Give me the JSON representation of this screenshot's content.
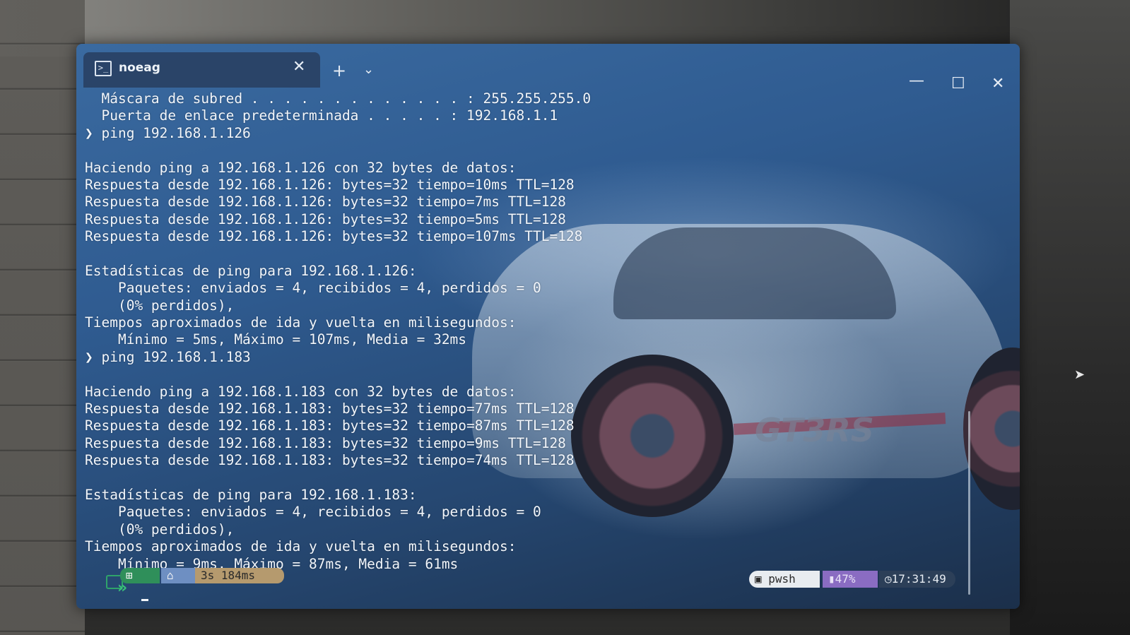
{
  "window": {
    "tab_title": "noeag",
    "tab_close": "✕",
    "new_tab": "+",
    "dropdown": "⌄",
    "minimize": "—",
    "maximize": "☐",
    "close": "✕"
  },
  "terminal": {
    "lines": [
      "  Máscara de subred . . . . . . . . . . . . . : 255.255.255.0",
      "  Puerta de enlace predeterminada . . . . . : 192.168.1.1",
      "❯ ping 192.168.1.126",
      "",
      "Haciendo ping a 192.168.1.126 con 32 bytes de datos:",
      "Respuesta desde 192.168.1.126: bytes=32 tiempo=10ms TTL=128",
      "Respuesta desde 192.168.1.126: bytes=32 tiempo=7ms TTL=128",
      "Respuesta desde 192.168.1.126: bytes=32 tiempo=5ms TTL=128",
      "Respuesta desde 192.168.1.126: bytes=32 tiempo=107ms TTL=128",
      "",
      "Estadísticas de ping para 192.168.1.126:",
      "    Paquetes: enviados = 4, recibidos = 4, perdidos = 0",
      "    (0% perdidos),",
      "Tiempos aproximados de ida y vuelta en milisegundos:",
      "    Mínimo = 5ms, Máximo = 107ms, Media = 32ms",
      "❯ ping 192.168.1.183",
      "",
      "Haciendo ping a 192.168.1.183 con 32 bytes de datos:",
      "Respuesta desde 192.168.1.183: bytes=32 tiempo=77ms TTL=128",
      "Respuesta desde 192.168.1.183: bytes=32 tiempo=87ms TTL=128",
      "Respuesta desde 192.168.1.183: bytes=32 tiempo=9ms TTL=128",
      "Respuesta desde 192.168.1.183: bytes=32 tiempo=74ms TTL=128",
      "",
      "Estadísticas de ping para 192.168.1.183:",
      "    Paquetes: enviados = 4, recibidos = 4, perdidos = 0",
      "    (0% perdidos),",
      "Tiempos aproximados de ida y vuelta en milisegundos:",
      "    Mínimo = 9ms, Máximo = 87ms, Media = 61ms"
    ]
  },
  "prompt": {
    "windows_glyph": "⊞",
    "home_glyph": "⌂",
    "duration": "3s 184ms",
    "chevrons": "»"
  },
  "status_right": {
    "shell": "pwsh",
    "battery": "47%",
    "clock": "17:31:49"
  },
  "background": {
    "car_text": "GT3RS"
  }
}
